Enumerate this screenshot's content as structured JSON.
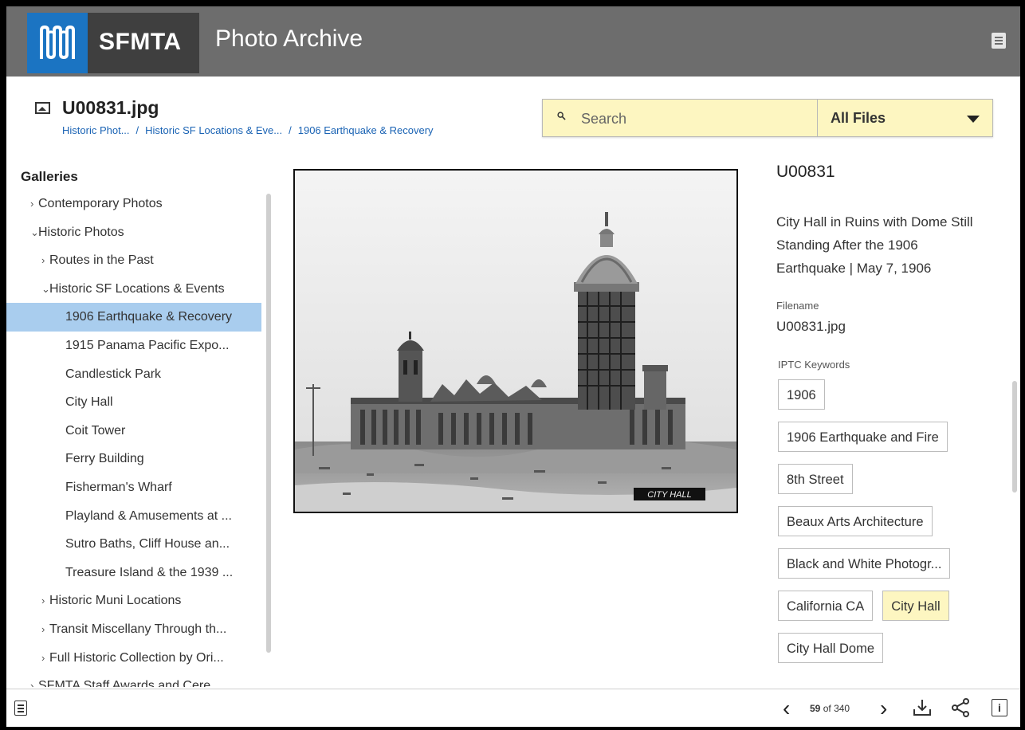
{
  "header": {
    "brand": "SFMTA",
    "app_title": "Photo Archive"
  },
  "file": {
    "title": "U00831.jpg",
    "breadcrumb": [
      "Historic Phot...",
      "Historic SF Locations & Eve...",
      "1906 Earthquake & Recovery"
    ]
  },
  "search": {
    "placeholder": "Search",
    "filter_selected": "All Files"
  },
  "sidebar": {
    "heading": "Galleries",
    "items": [
      {
        "label": "Contemporary Photos",
        "chev": ">",
        "indent": 0
      },
      {
        "label": "Historic Photos",
        "chev": "v",
        "indent": 0
      },
      {
        "label": "Routes in the Past",
        "chev": ">",
        "indent": 1
      },
      {
        "label": "Historic SF Locations & Events",
        "chev": "v",
        "indent": 1
      },
      {
        "label": "1906 Earthquake & Recovery",
        "chev": "",
        "indent": 2,
        "selected": true
      },
      {
        "label": "1915 Panama Pacific Expo...",
        "chev": "",
        "indent": 2
      },
      {
        "label": "Candlestick Park",
        "chev": "",
        "indent": 2
      },
      {
        "label": "City Hall",
        "chev": "",
        "indent": 2
      },
      {
        "label": "Coit Tower",
        "chev": "",
        "indent": 2
      },
      {
        "label": "Ferry Building",
        "chev": "",
        "indent": 2
      },
      {
        "label": "Fisherman's Wharf",
        "chev": "",
        "indent": 2
      },
      {
        "label": "Playland & Amusements at ...",
        "chev": "",
        "indent": 2
      },
      {
        "label": "Sutro Baths, Cliff House an...",
        "chev": "",
        "indent": 2
      },
      {
        "label": "Treasure Island & the 1939 ...",
        "chev": "",
        "indent": 2
      },
      {
        "label": "Historic Muni Locations",
        "chev": ">",
        "indent": 1
      },
      {
        "label": "Transit Miscellany Through th...",
        "chev": ">",
        "indent": 1
      },
      {
        "label": "Full Historic Collection by Ori...",
        "chev": ">",
        "indent": 1
      },
      {
        "label": "SFMTA Staff Awards and Cere...",
        "chev": ">",
        "indent": 0
      }
    ]
  },
  "photo": {
    "caption_label": "CITY HALL"
  },
  "details": {
    "id": "U00831",
    "description": "City Hall in Ruins with Dome Still Standing After the 1906 Earthquake | May 7, 1906",
    "filename_label": "Filename",
    "filename": "U00831.jpg",
    "keywords_label": "IPTC Keywords",
    "keywords": [
      {
        "text": "1906"
      },
      {
        "text": "1906 Earthquake and Fire"
      },
      {
        "text": "8th Street"
      },
      {
        "text": "Beaux Arts Architecture"
      },
      {
        "text": "Black and White Photogr..."
      },
      {
        "text": "California CA"
      },
      {
        "text": "City Hall",
        "highlight": true
      },
      {
        "text": "City Hall Dome"
      }
    ]
  },
  "pager": {
    "current": "59",
    "of_label": "of",
    "total": "340"
  },
  "colors": {
    "header_bg": "#6d6d6d",
    "logo_blue": "#1b74c2",
    "selected_bg": "#a9cdee",
    "search_bg": "#fdf6c1",
    "link": "#1a63b4"
  },
  "icons": [
    "sfmta-logo-icon",
    "menu-icon",
    "image-file-icon",
    "search-icon",
    "chevron-down-icon",
    "list-view-icon",
    "chevron-left-icon",
    "chevron-right-icon",
    "download-icon",
    "share-icon",
    "info-icon"
  ]
}
